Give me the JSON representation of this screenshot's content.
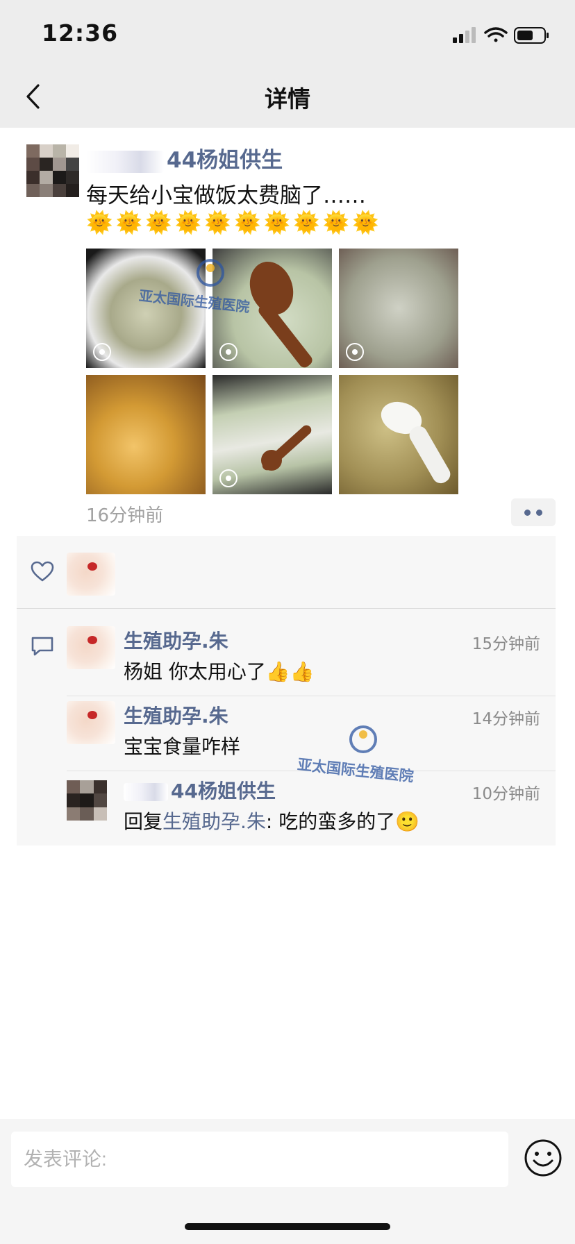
{
  "status_bar": {
    "time": "12:36"
  },
  "nav": {
    "title": "详情"
  },
  "post": {
    "author_name": "44杨姐供生",
    "text": "每天给小宝做饭太费脑了……",
    "emojis": "🌞🌞🌞🌞🌞🌞🌞🌞🌞🌞",
    "time": "16分钟前",
    "photo_count": 6
  },
  "watermark": {
    "text": "亚太国际生殖医院"
  },
  "comments": [
    {
      "name": "生殖助孕.朱",
      "time": "15分钟前",
      "text": "杨姐 你太用心了👍👍"
    },
    {
      "name": "生殖助孕.朱",
      "time": "14分钟前",
      "text": "宝宝食量咋样"
    },
    {
      "name": "44杨姐供生",
      "time": "10分钟前",
      "reply_prefix": "回复",
      "reply_to": "生殖助孕.朱",
      "reply_text": ": 吃的蛮多的了🙂"
    }
  ],
  "comment_bar": {
    "placeholder": "发表评论:"
  },
  "colors": {
    "link": "#57698f",
    "bar_bg": "#ededed",
    "interaction_bg": "#f7f7f7"
  }
}
